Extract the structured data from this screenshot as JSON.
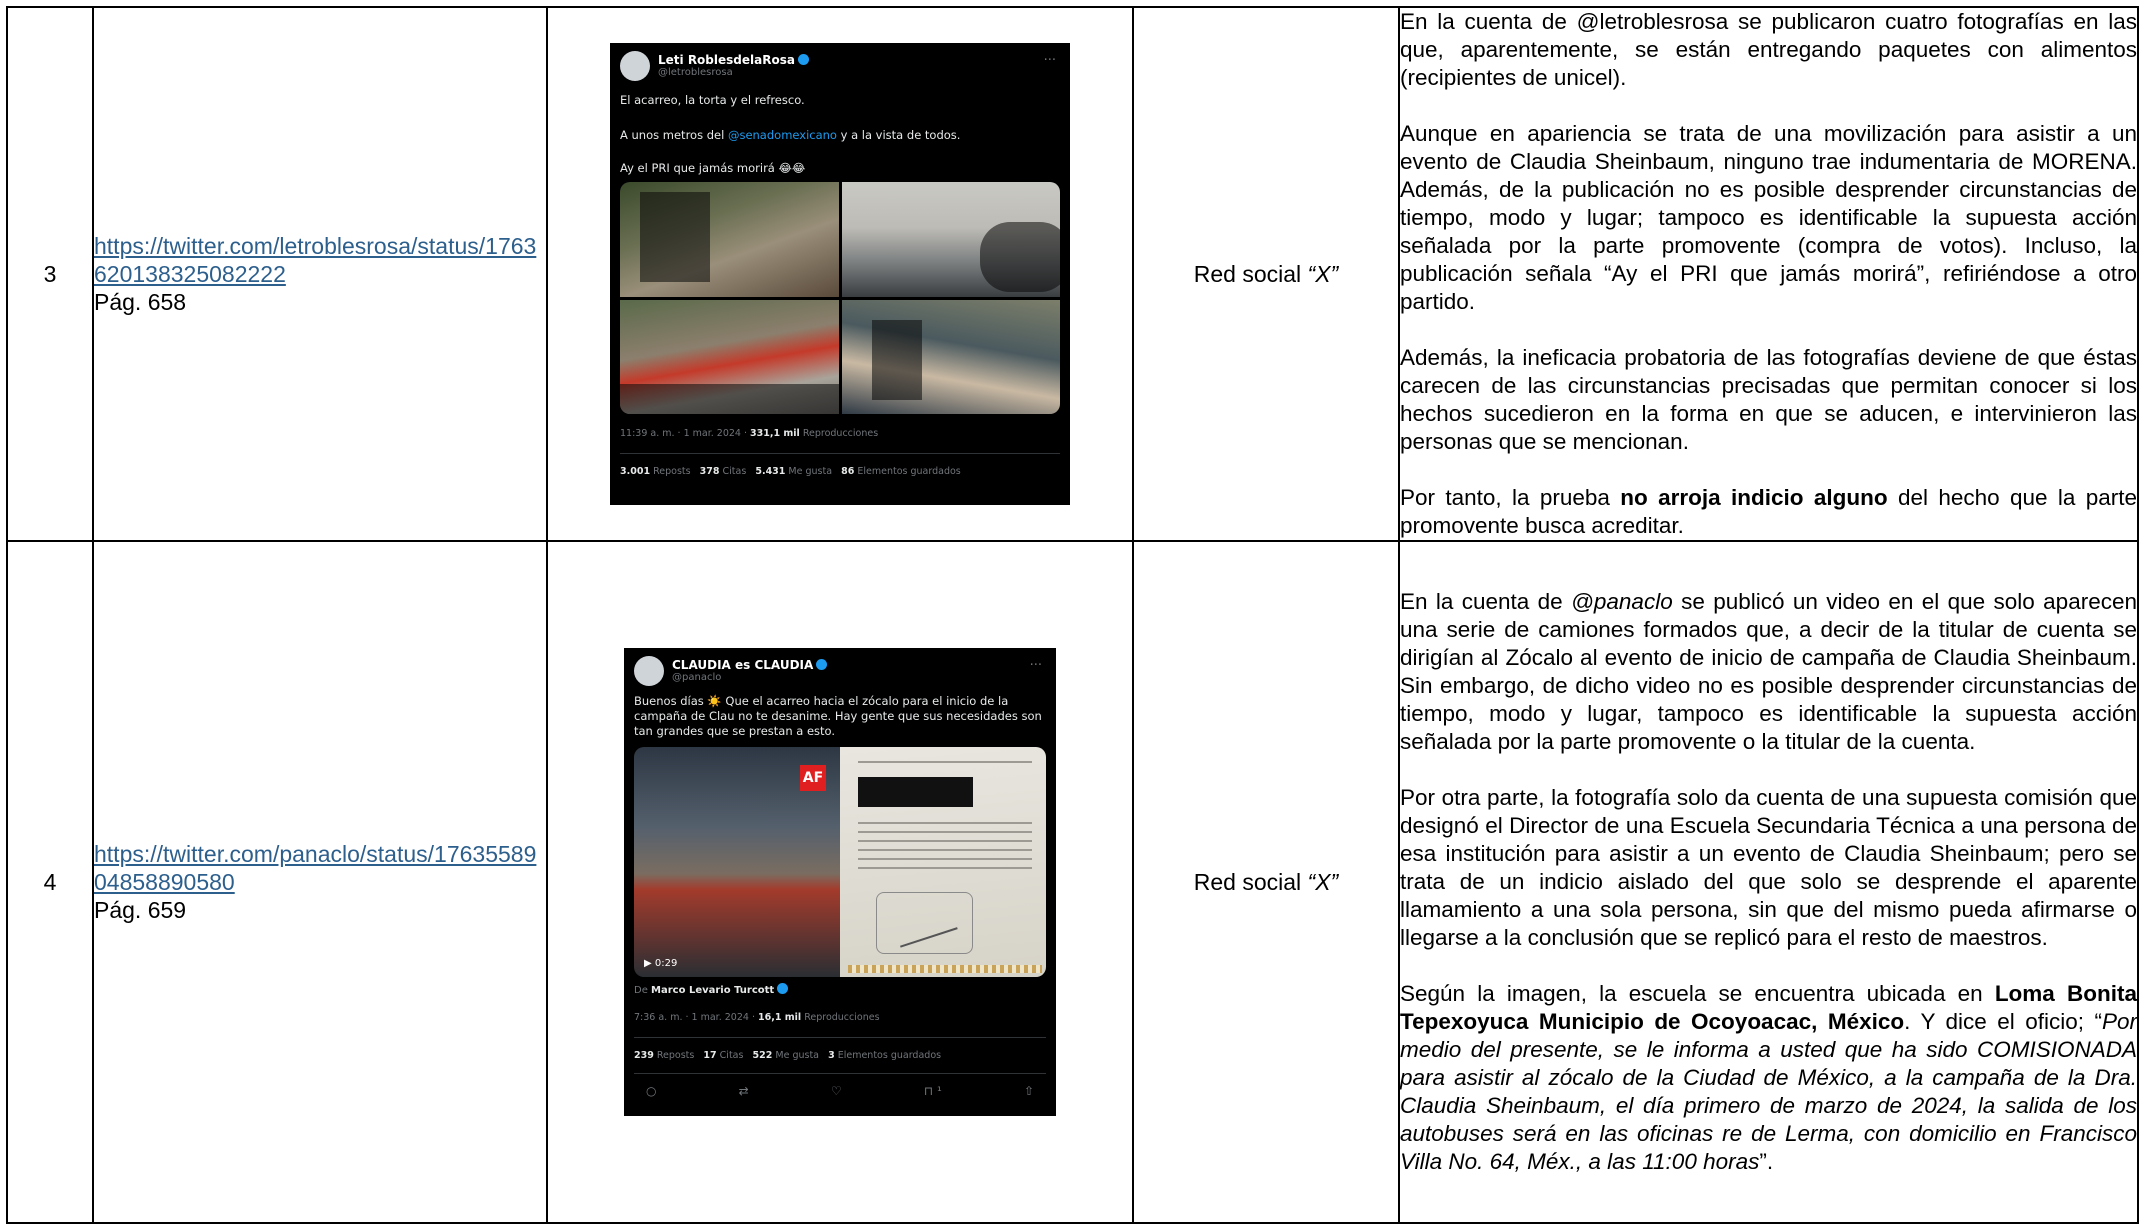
{
  "rows": [
    {
      "number": "3",
      "link": "https://twitter.com/letroblesrosa/status/1763620138325082222",
      "page": "Pág. 658",
      "medium": {
        "prefix": "Red social ",
        "italic": "“X”"
      },
      "tweet": {
        "name": "Leti RoblesdelaRosa",
        "handle": "@letroblesrosa",
        "line1": "El acarreo, la torta y el refresco.",
        "line2_pre": "A unos metros del ",
        "line2_mention": "@senadomexicano",
        "line2_post": " y a la vista de todos.",
        "line3": "Ay el PRI que jamás morirá 😂😂",
        "meta_time": "11:39 a. m. · 1 mar. 2024 · ",
        "meta_views": "331,1 mil",
        "meta_views_label": " Reproducciones",
        "stats": [
          {
            "n": "3.001",
            "l": " Reposts"
          },
          {
            "n": "378",
            "l": " Citas"
          },
          {
            "n": "5.431",
            "l": " Me gusta"
          },
          {
            "n": "86",
            "l": " Elementos guardados"
          }
        ],
        "more": "···"
      },
      "description": {
        "p1": "En la cuenta de @letroblesrosa se publicaron cuatro fotografías en las que, aparentemente, se están entregando paquetes con alimentos (recipientes de unicel).",
        "p2": "Aunque en apariencia se trata de una movilización para asistir a un evento de Claudia Sheinbaum, ninguno trae indumentaria de MORENA. Además, de la publicación no es posible desprender circunstancias de tiempo, modo y lugar; tampoco es identificable la supuesta acción señalada por la parte promovente (compra de votos). Incluso, la publicación señala “Ay el PRI que jamás morirá”, refiriéndose a otro partido.",
        "p3": "Además, la ineficacia probatoria de las fotografías deviene de que éstas carecen de las circunstancias precisadas que permitan conocer si los hechos sucedieron en la forma en que se aducen, e intervinieron las personas que se mencionan.",
        "p4_pre": "Por tanto, la prueba ",
        "p4_bold": "no arroja indicio alguno",
        "p4_post": " del hecho que la parte promovente busca acreditar."
      }
    },
    {
      "number": "4",
      "link": "https://twitter.com/panaclo/status/1763558904858890580",
      "page": "Pág. 659",
      "medium": {
        "prefix": "Red social ",
        "italic": "“X”"
      },
      "tweet": {
        "name": "CLAUDIA es CLAUDIA",
        "handle": "@panaclo",
        "text_pre": "Buenos días ",
        "sun": "☀️",
        "text_post": " Que el acarreo hacia el zócalo para el inicio de la campaña de Clau no te desanime. Hay gente que sus necesidades son tan grandes que se prestan a esto.",
        "af": "AF",
        "video_time": "▶ 0:29",
        "from_pre": "De ",
        "from_name": "Marco Levario Turcott",
        "meta_time": "7:36 a. m. · 1 mar. 2024 · ",
        "meta_views": "16,1 mil",
        "meta_views_label": " Reproducciones",
        "stats": [
          {
            "n": "239",
            "l": " Reposts"
          },
          {
            "n": "17",
            "l": " Citas"
          },
          {
            "n": "522",
            "l": " Me gusta"
          },
          {
            "n": "3",
            "l": " Elementos guardados"
          }
        ],
        "more": "···",
        "actions": [
          "○",
          "⇄",
          "♡",
          "⊓ ¹",
          "⇧"
        ]
      },
      "description": {
        "p1_pre": "En la cuenta de ",
        "p1_italic": "@panaclo",
        "p1_post": " se publicó un video en el que solo aparecen una serie de camiones formados que, a decir de la titular de cuenta se dirigían al Zócalo al evento de inicio de campaña de Claudia Sheinbaum. Sin embargo, de dicho video no es posible desprender circunstancias de tiempo, modo y lugar, tampoco es identificable la supuesta acción señalada por la parte promovente o la titular de la cuenta.",
        "p2": "Por otra parte, la fotografía solo da cuenta de una supuesta comisión que designó el Director de una Escuela Secundaria Técnica a una persona de esa institución para asistir a un evento de Claudia Sheinbaum; pero se trata de un indicio aislado del que solo se desprende el aparente llamamiento a una sola persona, sin que del mismo pueda afirmarse o llegarse a la conclusión que se replicó para el resto de maestros.",
        "p3_pre": "Según la imagen, la escuela se encuentra ubicada en ",
        "p3_bold": "Loma Bonita Tepexoyuca Municipio de Ocoyoacac, México",
        "p3_mid": ". Y dice el oficio; “",
        "p3_italic": "Por medio del presente, se le informa a usted que ha sido COMISIONADA para asistir al zócalo de la Ciudad de México, a la campaña de la Dra. Claudia Sheinbaum, el día primero de marzo de 2024, la salida de los autobuses será en las oficinas re de Lerma, con domicilio en Francisco Villa No. 64, Méx., a las 11:00 horas",
        "p3_end": "”."
      }
    }
  ]
}
